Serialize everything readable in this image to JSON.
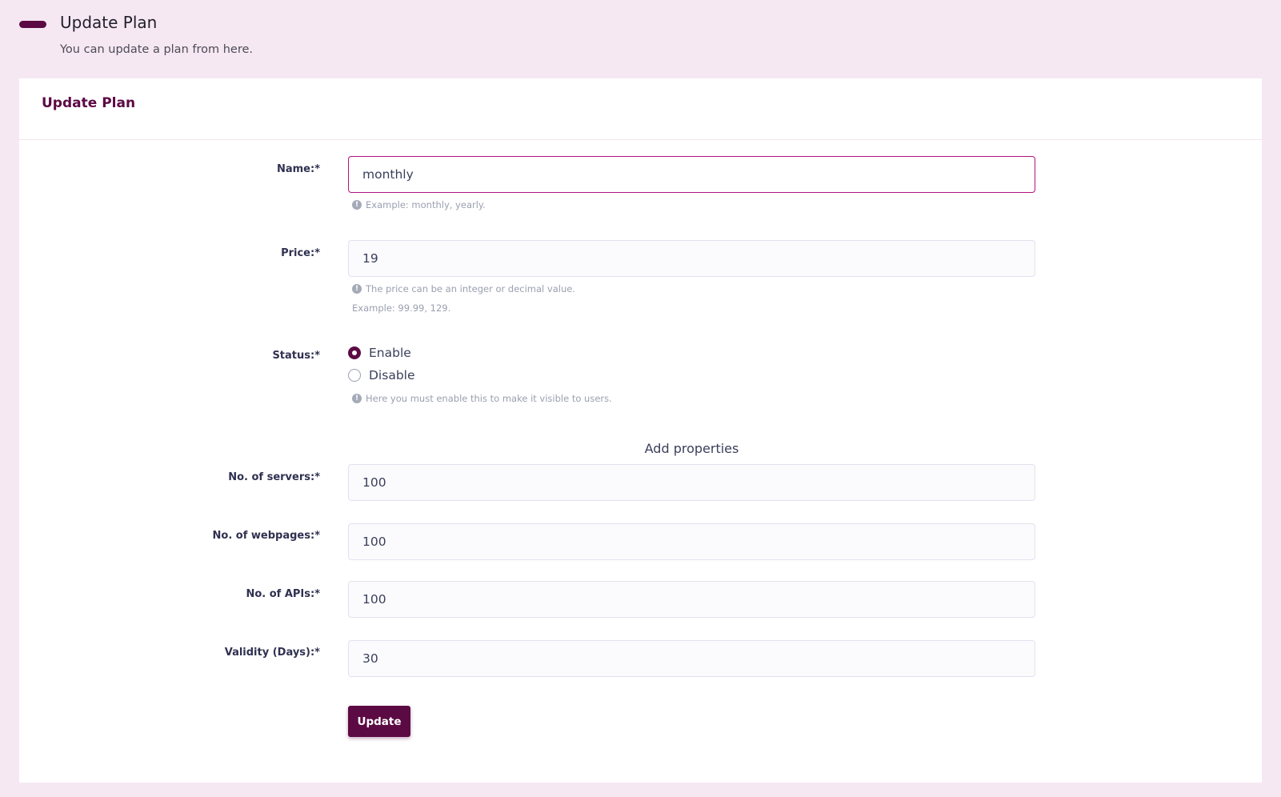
{
  "header": {
    "title": "Update Plan",
    "subtitle": "You can update a plan from here."
  },
  "card": {
    "title": "Update Plan"
  },
  "form": {
    "name": {
      "label": "Name:*",
      "value": "monthly",
      "hint": "Example: monthly, yearly."
    },
    "price": {
      "label": "Price:*",
      "value": "19",
      "hint": "The price can be an integer or decimal value.",
      "hint2": "Example: 99.99, 129."
    },
    "status": {
      "label": "Status:*",
      "options": [
        {
          "label": "Enable",
          "checked": true
        },
        {
          "label": "Disable",
          "checked": false
        }
      ],
      "hint": "Here you must enable this to make it visible to users."
    },
    "properties_title": "Add properties",
    "servers": {
      "label": "No. of servers:*",
      "value": "100"
    },
    "webpages": {
      "label": "No. of webpages:*",
      "value": "100"
    },
    "apis": {
      "label": "No. of APIs:*",
      "value": "100"
    },
    "validity": {
      "label": "Validity (Days):*",
      "value": "30"
    },
    "submit_label": "Update"
  },
  "icons": {
    "header_marker": "pill-icon",
    "hint": "info-circle-icon"
  },
  "colors": {
    "brand": "#5c0a44",
    "focus_border": "#b0127d",
    "page_background": "#f6e8f2"
  }
}
